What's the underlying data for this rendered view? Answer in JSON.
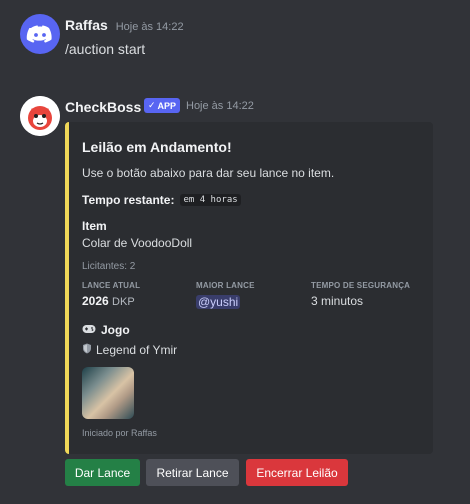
{
  "message1": {
    "username": "Raffas",
    "timestamp": "Hoje às 14:22",
    "content": "/auction start",
    "avatar_icon": "discord-logo-icon"
  },
  "message2": {
    "username": "CheckBoss",
    "badge": "APP",
    "timestamp": "Hoje às 14:22",
    "avatar_icon": "checkboss-avatar-icon"
  },
  "embed": {
    "accent_color": "#f0d858",
    "title": "Leilão em Andamento!",
    "description": "Use o botão abaixo para dar seu lance no item.",
    "time_label": "Tempo restante:",
    "time_value": "em 4 horas",
    "item_label": "Item",
    "item_value": "Colar de VoodooDoll",
    "bidders": "Licitantes: 2",
    "col1_header": "LANCE ATUAL",
    "col1_value": "2026",
    "col1_unit": "DKP",
    "col2_header": "MAIOR LANCE",
    "col2_value": "@yushi",
    "col3_header": "TEMPO DE SEGURANÇA",
    "col3_value": "3 minutos",
    "game_label": "Jogo",
    "game_value": "Legend of Ymir",
    "footer": "Iniciado por Raffas"
  },
  "buttons": {
    "bid": "Dar Lance",
    "retract": "Retirar Lance",
    "end": "Encerrar Leilão"
  },
  "colors": {
    "bid": "#248046",
    "retract": "#4e5058",
    "end": "#da373c",
    "badge": "#5865f2"
  }
}
